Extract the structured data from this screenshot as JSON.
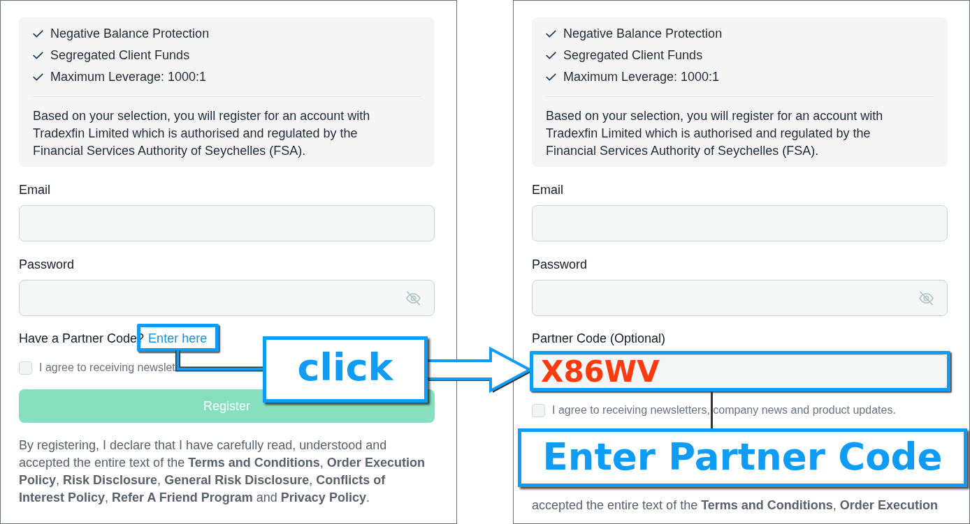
{
  "panels": [
    {
      "features": [
        "Negative Balance Protection",
        "Segregated Client Funds",
        "Maximum Leverage: 1000:1"
      ],
      "notice": "Based on your selection, you will register for an account with Tradexfin Limited which is authorised and regulated by the Financial Services Authority of Seychelles (FSA).",
      "fields": [
        {
          "kind": "text",
          "label": "Email"
        },
        {
          "kind": "password",
          "label": "Password"
        }
      ],
      "partner_code": {
        "kind": "link",
        "prompt": "Have a Partner Code?",
        "link": "Enter here"
      },
      "newsletter": {
        "label": "I agree to receiving newslet",
        "checked": false
      },
      "register_button": {
        "label": "Register",
        "disabled": true
      },
      "disclaimer": "By registering, I declare that I have carefully read, understood and accepted the entire text of the **Terms and Conditions**, **Order Execution Policy**, **Risk Disclosure**, **General Risk Disclosure**, **Conflicts of Interest Policy**, **Refer A Friend Program** and **Privacy Policy**."
    },
    {
      "features": [
        "Negative Balance Protection",
        "Segregated Client Funds",
        "Maximum Leverage: 1000:1"
      ],
      "notice": "Based on your selection, you will register for an account with Tradexfin Limited which is authorised and regulated by the Financial Services Authority of Seychelles (FSA).",
      "fields": [
        {
          "kind": "text",
          "label": "Email"
        },
        {
          "kind": "password",
          "label": "Password"
        }
      ],
      "partner_code": {
        "kind": "field",
        "label": "Partner Code (Optional)",
        "value": "X86WV"
      },
      "newsletter": {
        "label": "I agree to receiving newsletters, company news and product updates.",
        "checked": false
      },
      "disclaimer": "accepted the entire text of the **Terms and Conditions**, **Order Execution**"
    }
  ],
  "callouts": [
    {
      "text": "click"
    },
    {
      "text": "Enter Partner Code"
    }
  ]
}
